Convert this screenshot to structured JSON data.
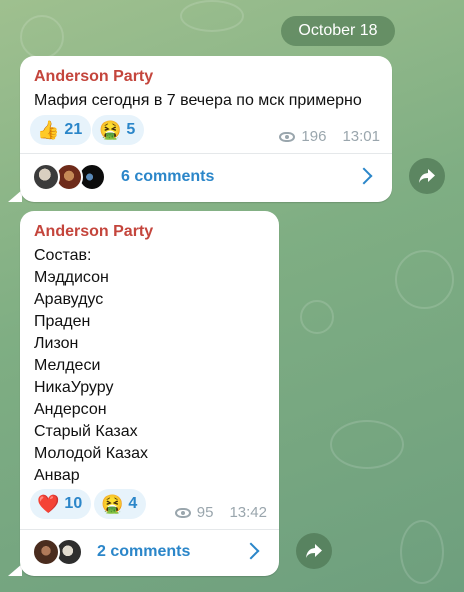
{
  "date_pill": "October 18",
  "messages": [
    {
      "sender": "Anderson Party",
      "text": "Мафия сегодня в 7 вечера по мск примерно",
      "reactions": [
        {
          "emoji": "👍",
          "count": "21"
        },
        {
          "emoji": "🤮",
          "count": "5"
        }
      ],
      "views": "196",
      "time": "13:01",
      "comments_label": "6 comments",
      "commenter_avatars": 3
    },
    {
      "sender": "Anderson Party",
      "text": "Состав:\nМэддисон\nАравудус\nПраден\nЛизон\nМелдеси\nНикаУруру\nАндерсон\nСтарый Казах\nМолодой Казах\nАнвар",
      "reactions": [
        {
          "emoji": "❤️",
          "count": "10"
        },
        {
          "emoji": "🤮",
          "count": "4"
        }
      ],
      "views": "95",
      "time": "13:42",
      "comments_label": "2 comments",
      "commenter_avatars": 2
    }
  ],
  "colors": {
    "sender": "#c4453c",
    "accent": "#2b86c9",
    "reaction_bg": "#e7f3fb",
    "meta": "#9aa6ad"
  },
  "icons": {
    "views": "eye-icon",
    "comments_arrow": "chevron-right-icon",
    "share": "share-arrow-icon"
  }
}
